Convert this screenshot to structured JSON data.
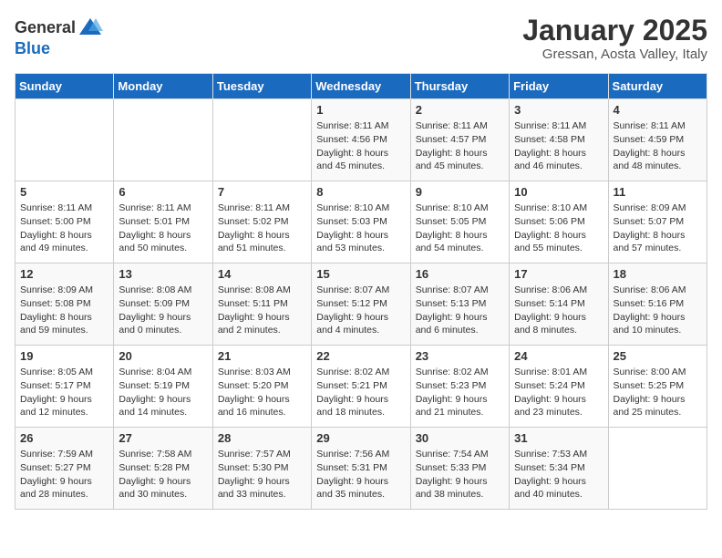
{
  "logo": {
    "general": "General",
    "blue": "Blue"
  },
  "title": "January 2025",
  "subtitle": "Gressan, Aosta Valley, Italy",
  "weekdays": [
    "Sunday",
    "Monday",
    "Tuesday",
    "Wednesday",
    "Thursday",
    "Friday",
    "Saturday"
  ],
  "weeks": [
    [
      {
        "day": "",
        "info": ""
      },
      {
        "day": "",
        "info": ""
      },
      {
        "day": "",
        "info": ""
      },
      {
        "day": "1",
        "info": "Sunrise: 8:11 AM\nSunset: 4:56 PM\nDaylight: 8 hours\nand 45 minutes."
      },
      {
        "day": "2",
        "info": "Sunrise: 8:11 AM\nSunset: 4:57 PM\nDaylight: 8 hours\nand 45 minutes."
      },
      {
        "day": "3",
        "info": "Sunrise: 8:11 AM\nSunset: 4:58 PM\nDaylight: 8 hours\nand 46 minutes."
      },
      {
        "day": "4",
        "info": "Sunrise: 8:11 AM\nSunset: 4:59 PM\nDaylight: 8 hours\nand 48 minutes."
      }
    ],
    [
      {
        "day": "5",
        "info": "Sunrise: 8:11 AM\nSunset: 5:00 PM\nDaylight: 8 hours\nand 49 minutes."
      },
      {
        "day": "6",
        "info": "Sunrise: 8:11 AM\nSunset: 5:01 PM\nDaylight: 8 hours\nand 50 minutes."
      },
      {
        "day": "7",
        "info": "Sunrise: 8:11 AM\nSunset: 5:02 PM\nDaylight: 8 hours\nand 51 minutes."
      },
      {
        "day": "8",
        "info": "Sunrise: 8:10 AM\nSunset: 5:03 PM\nDaylight: 8 hours\nand 53 minutes."
      },
      {
        "day": "9",
        "info": "Sunrise: 8:10 AM\nSunset: 5:05 PM\nDaylight: 8 hours\nand 54 minutes."
      },
      {
        "day": "10",
        "info": "Sunrise: 8:10 AM\nSunset: 5:06 PM\nDaylight: 8 hours\nand 55 minutes."
      },
      {
        "day": "11",
        "info": "Sunrise: 8:09 AM\nSunset: 5:07 PM\nDaylight: 8 hours\nand 57 minutes."
      }
    ],
    [
      {
        "day": "12",
        "info": "Sunrise: 8:09 AM\nSunset: 5:08 PM\nDaylight: 8 hours\nand 59 minutes."
      },
      {
        "day": "13",
        "info": "Sunrise: 8:08 AM\nSunset: 5:09 PM\nDaylight: 9 hours\nand 0 minutes."
      },
      {
        "day": "14",
        "info": "Sunrise: 8:08 AM\nSunset: 5:11 PM\nDaylight: 9 hours\nand 2 minutes."
      },
      {
        "day": "15",
        "info": "Sunrise: 8:07 AM\nSunset: 5:12 PM\nDaylight: 9 hours\nand 4 minutes."
      },
      {
        "day": "16",
        "info": "Sunrise: 8:07 AM\nSunset: 5:13 PM\nDaylight: 9 hours\nand 6 minutes."
      },
      {
        "day": "17",
        "info": "Sunrise: 8:06 AM\nSunset: 5:14 PM\nDaylight: 9 hours\nand 8 minutes."
      },
      {
        "day": "18",
        "info": "Sunrise: 8:06 AM\nSunset: 5:16 PM\nDaylight: 9 hours\nand 10 minutes."
      }
    ],
    [
      {
        "day": "19",
        "info": "Sunrise: 8:05 AM\nSunset: 5:17 PM\nDaylight: 9 hours\nand 12 minutes."
      },
      {
        "day": "20",
        "info": "Sunrise: 8:04 AM\nSunset: 5:19 PM\nDaylight: 9 hours\nand 14 minutes."
      },
      {
        "day": "21",
        "info": "Sunrise: 8:03 AM\nSunset: 5:20 PM\nDaylight: 9 hours\nand 16 minutes."
      },
      {
        "day": "22",
        "info": "Sunrise: 8:02 AM\nSunset: 5:21 PM\nDaylight: 9 hours\nand 18 minutes."
      },
      {
        "day": "23",
        "info": "Sunrise: 8:02 AM\nSunset: 5:23 PM\nDaylight: 9 hours\nand 21 minutes."
      },
      {
        "day": "24",
        "info": "Sunrise: 8:01 AM\nSunset: 5:24 PM\nDaylight: 9 hours\nand 23 minutes."
      },
      {
        "day": "25",
        "info": "Sunrise: 8:00 AM\nSunset: 5:25 PM\nDaylight: 9 hours\nand 25 minutes."
      }
    ],
    [
      {
        "day": "26",
        "info": "Sunrise: 7:59 AM\nSunset: 5:27 PM\nDaylight: 9 hours\nand 28 minutes."
      },
      {
        "day": "27",
        "info": "Sunrise: 7:58 AM\nSunset: 5:28 PM\nDaylight: 9 hours\nand 30 minutes."
      },
      {
        "day": "28",
        "info": "Sunrise: 7:57 AM\nSunset: 5:30 PM\nDaylight: 9 hours\nand 33 minutes."
      },
      {
        "day": "29",
        "info": "Sunrise: 7:56 AM\nSunset: 5:31 PM\nDaylight: 9 hours\nand 35 minutes."
      },
      {
        "day": "30",
        "info": "Sunrise: 7:54 AM\nSunset: 5:33 PM\nDaylight: 9 hours\nand 38 minutes."
      },
      {
        "day": "31",
        "info": "Sunrise: 7:53 AM\nSunset: 5:34 PM\nDaylight: 9 hours\nand 40 minutes."
      },
      {
        "day": "",
        "info": ""
      }
    ]
  ]
}
